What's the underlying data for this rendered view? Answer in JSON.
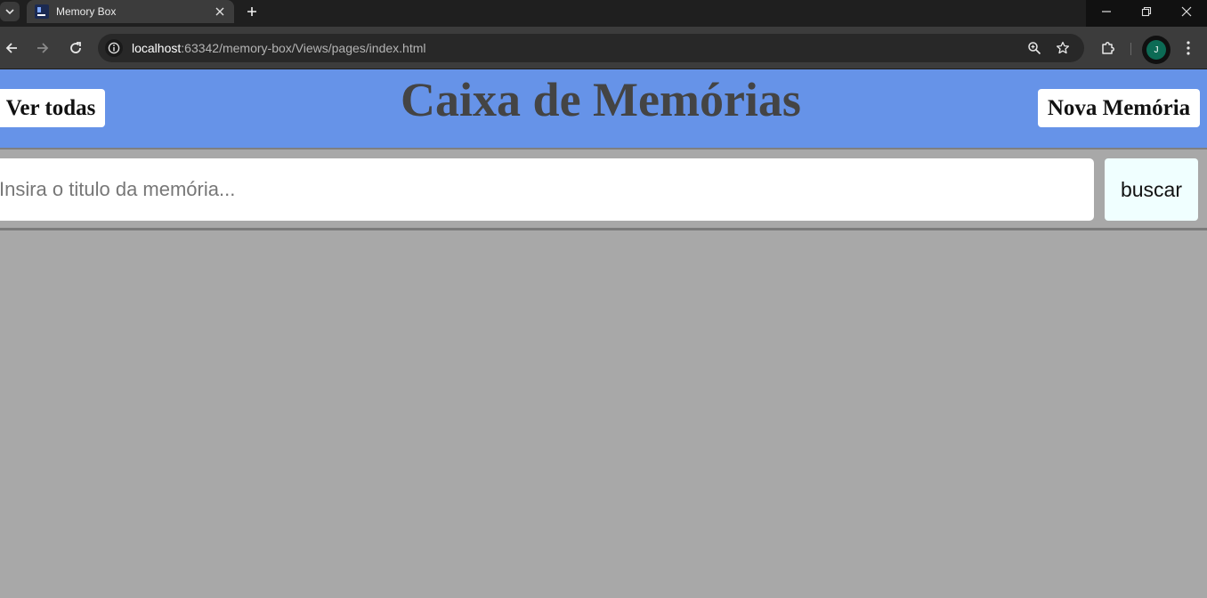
{
  "browser": {
    "tab": {
      "title": "Memory Box",
      "favicon": "intellij-icon"
    },
    "url": {
      "host": "localhost",
      "rest": ":63342/memory-box/Views/pages/index.html"
    },
    "avatar_initial": "J"
  },
  "page": {
    "title": "Caixa de Memórias",
    "view_all_label": "Ver todas",
    "new_memory_label": "Nova Memória",
    "search": {
      "placeholder": "Insira o titulo da memória...",
      "button_label": "buscar"
    }
  },
  "colors": {
    "header_bg": "#6693e8",
    "page_bg": "#a8a8a8",
    "title_text": "#444444",
    "search_button_bg": "#f0ffff"
  }
}
